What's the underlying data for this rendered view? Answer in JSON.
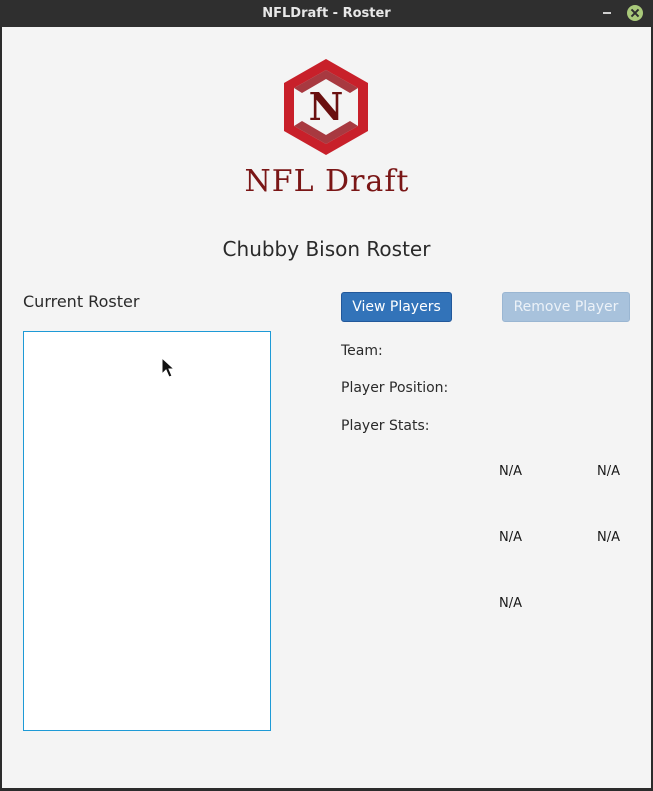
{
  "window": {
    "title": "NFLDraft - Roster"
  },
  "logo": {
    "letter": "N",
    "text": "NFL Draft",
    "colors": {
      "hex": "#c8202a",
      "text": "#7a1616"
    }
  },
  "page": {
    "roster_title": "Chubby Bison Roster",
    "current_roster_label": "Current Roster"
  },
  "buttons": {
    "view_players": "View Players",
    "remove_player": "Remove Player"
  },
  "details": {
    "team_label": "Team:",
    "position_label": "Player Position:",
    "stats_label": "Player Stats:"
  },
  "stats": [
    "N/A",
    "N/A",
    "N/A",
    "N/A",
    "N/A"
  ],
  "roster_items": []
}
